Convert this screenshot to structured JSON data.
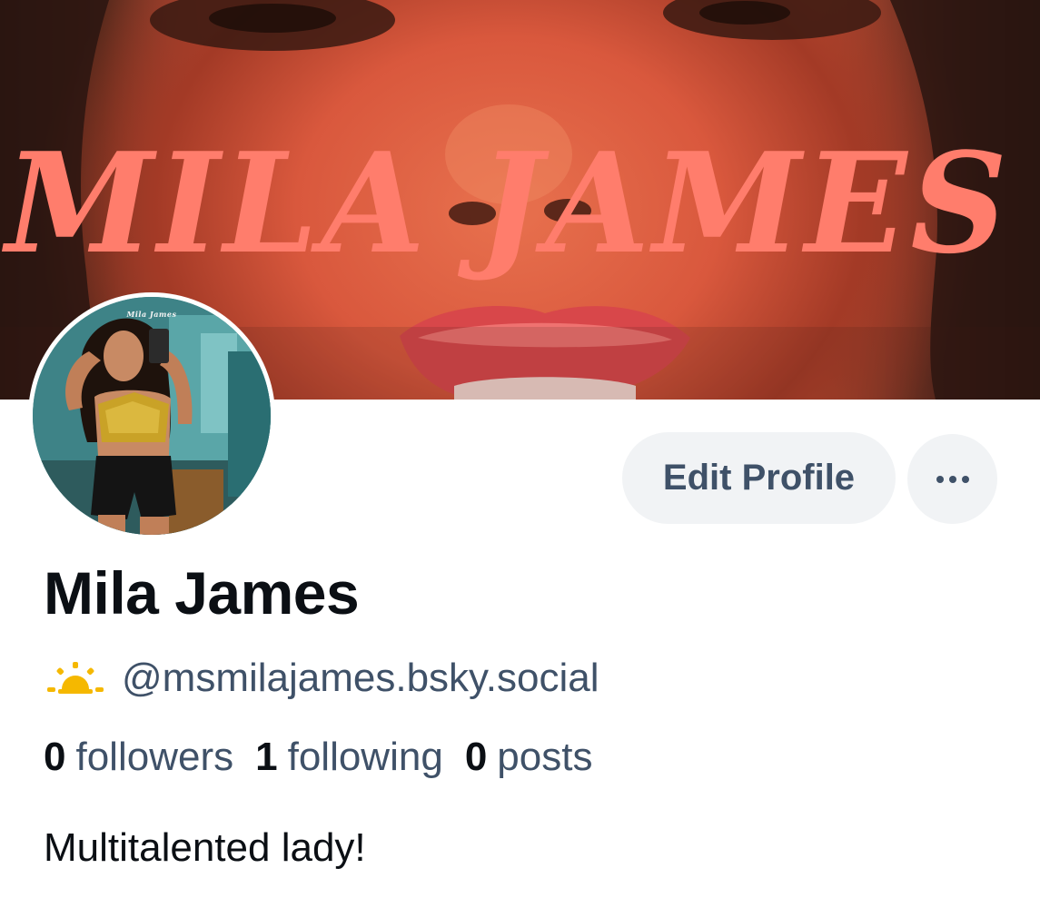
{
  "banner": {
    "title": "MILA JAMES",
    "title_color": "#ff7d6c"
  },
  "avatar": {
    "caption": "Mila James"
  },
  "actions": {
    "edit_profile_label": "Edit Profile",
    "more_icon": "ellipsis-icon"
  },
  "profile": {
    "display_name": "Mila James",
    "status_icon": "sun-icon",
    "handle": "@msmilajames.bsky.social",
    "bio": "Multitalented lady!"
  },
  "stats": {
    "followers": {
      "count": "0",
      "label": "followers"
    },
    "following": {
      "count": "1",
      "label": "following"
    },
    "posts": {
      "count": "0",
      "label": "posts"
    }
  },
  "colors": {
    "text_primary": "#0b0f14",
    "text_secondary": "#3f5168",
    "button_bg": "#f1f3f5",
    "sun_accent": "#f5b800"
  }
}
